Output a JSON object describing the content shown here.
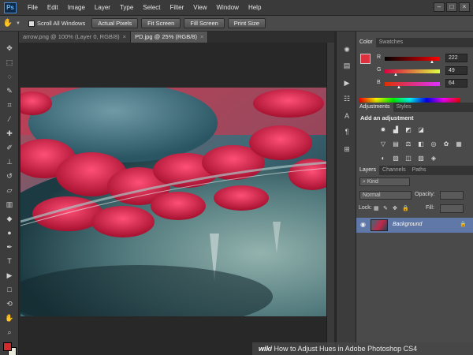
{
  "app": {
    "logo": "Ps"
  },
  "menu": [
    "File",
    "Edit",
    "Image",
    "Layer",
    "Type",
    "Select",
    "Filter",
    "View",
    "Window",
    "Help"
  ],
  "window_controls": [
    "–",
    "□",
    "×"
  ],
  "options_bar": {
    "tool_icon": "hand-icon",
    "scroll_all_label": "Scroll All Windows",
    "buttons": [
      "Actual Pixels",
      "Fit Screen",
      "Fill Screen",
      "Print Size"
    ]
  },
  "tabs": [
    {
      "label": "arrow.png @ 100% (Layer 0, RGB/8)",
      "active": false
    },
    {
      "label": "PD.jpg @ 25% (RGB/8)",
      "active": true
    }
  ],
  "color_panel": {
    "tabs": [
      "Color",
      "Swatches"
    ],
    "foreground": "#de3140",
    "background": "#1a1a1a",
    "channels": [
      {
        "label": "R",
        "value": "222",
        "fraction": 0.87
      },
      {
        "label": "G",
        "value": "49",
        "fraction": 0.19
      },
      {
        "label": "B",
        "value": "64",
        "fraction": 0.25
      }
    ]
  },
  "adjustments_panel": {
    "tabs": [
      "Adjustments",
      "Styles"
    ],
    "title": "Add an adjustment",
    "icons": [
      "brightness-icon",
      "levels-icon",
      "curves-icon",
      "exposure-icon",
      "vibrance-icon",
      "hue-saturation-icon",
      "color-balance-icon",
      "black-white-icon",
      "photo-filter-icon",
      "channel-mixer-icon",
      "color-lookup-icon",
      "invert-icon",
      "posterize-icon",
      "threshold-icon",
      "gradient-map-icon",
      "selective-color-icon"
    ]
  },
  "layers_panel": {
    "tabs": [
      "Layers",
      "Channels",
      "Paths"
    ],
    "kind_label": "Kind",
    "blend_mode": "Normal",
    "opacity_label": "Opacity:",
    "lock_label": "Lock:",
    "fill_label": "Fill:",
    "layer": {
      "name": "Background",
      "visible": true,
      "locked": true
    }
  },
  "watermark": {
    "brand": "wiki",
    "text": "How to Adjust Hues in Adobe Photoshop CS4"
  }
}
